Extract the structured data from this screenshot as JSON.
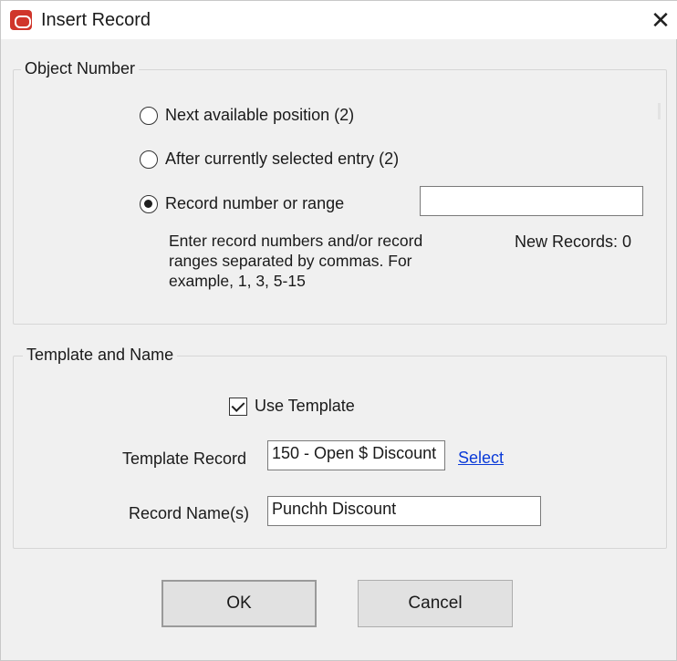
{
  "window": {
    "title": "Insert Record",
    "close_glyph": "✕"
  },
  "object_number": {
    "group_label": "Object Number",
    "options": [
      {
        "label": "Next available position (2)",
        "checked": false
      },
      {
        "label": "After currently selected entry (2)",
        "checked": false
      },
      {
        "label": "Record number or range",
        "checked": true
      }
    ],
    "range_value": "",
    "help_text": "Enter record numbers and/or record ranges separated by commas. For example, 1, 3, 5-15",
    "new_records": "New Records: 0"
  },
  "template_and_name": {
    "group_label": "Template and Name",
    "use_template_label": "Use Template",
    "use_template_checked": true,
    "template_record_label": "Template Record",
    "template_record_value": "150 - Open $ Discount",
    "select_link": "Select",
    "record_names_label": "Record Name(s)",
    "record_names_value": "Punchh Discount"
  },
  "buttons": {
    "ok": "OK",
    "cancel": "Cancel"
  },
  "colors": {
    "accent_icon": "#d0362b",
    "link": "#0a3ad8",
    "background": "#f0f0f0"
  },
  "icons": {
    "app": "oracle-app-icon",
    "close": "close-icon"
  }
}
